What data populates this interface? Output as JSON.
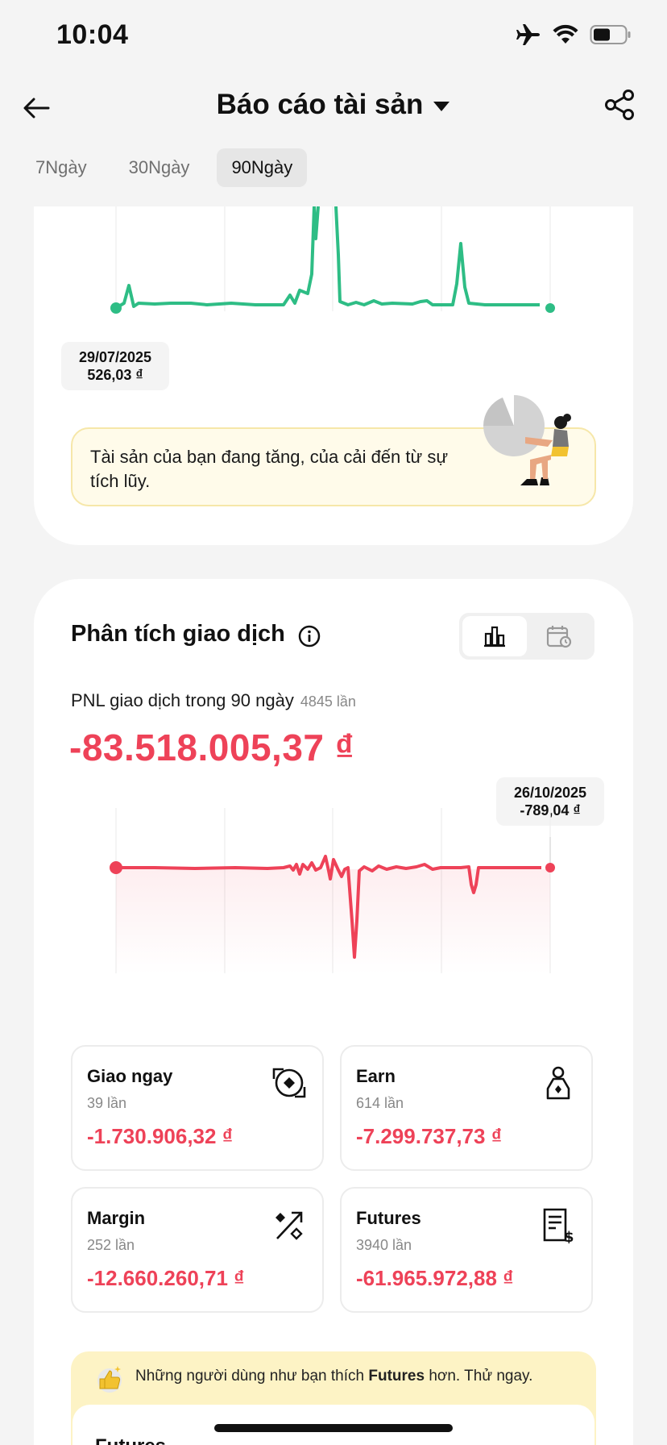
{
  "status_bar": {
    "time": "10:04"
  },
  "header": {
    "title": "Báo cáo tài sản"
  },
  "period_tabs": [
    {
      "label": "7Ngày",
      "active": false
    },
    {
      "label": "30Ngày",
      "active": false
    },
    {
      "label": "90Ngày",
      "active": true
    }
  ],
  "asset_chart": {
    "tooltip_date": "29/07/2025",
    "tooltip_value": "526,03 ₫",
    "notice": "Tài sản của bạn đang tăng, của cải đến từ sự tích lũy."
  },
  "trade_analysis": {
    "title": "Phân tích giao dịch",
    "pnl_label": "PNL giao dịch trong 90 ngày",
    "pnl_count": "4845 lần",
    "pnl_value": "-83.518.005,37 ₫",
    "tooltip_date": "26/10/2025",
    "tooltip_value": "-789,04 ₫",
    "accent_color": "#ee4258"
  },
  "stats": [
    {
      "name": "Giao ngay",
      "count": "39 lần",
      "value": "-1.730.906,32 ₫",
      "icon": "spot-icon"
    },
    {
      "name": "Earn",
      "count": "614 lần",
      "value": "-7.299.737,73 ₫",
      "icon": "earn-icon"
    },
    {
      "name": "Margin",
      "count": "252 lần",
      "value": "-12.660.260,71 ₫",
      "icon": "margin-icon"
    },
    {
      "name": "Futures",
      "count": "3940 lần",
      "value": "-61.965.972,88 ₫",
      "icon": "futures-icon"
    }
  ],
  "promo": {
    "text_before": "Những người dùng như bạn thích",
    "highlight": "Futures",
    "text_after": "hơn. Thử ngay.",
    "card_label": "Futures"
  }
}
